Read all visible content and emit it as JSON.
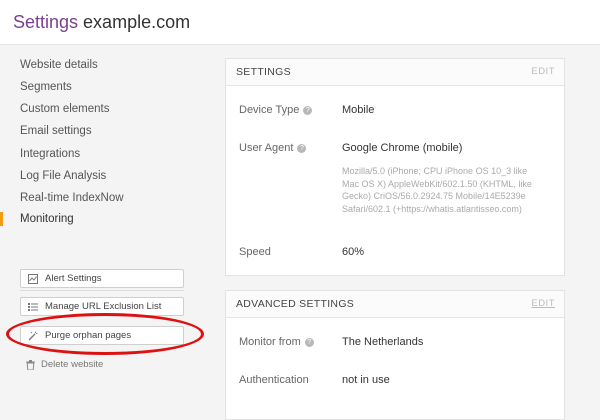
{
  "header": {
    "title_accent": "Settings",
    "title_rest": " example.com"
  },
  "sidebar": {
    "items": [
      {
        "label": "Website details"
      },
      {
        "label": "Segments"
      },
      {
        "label": "Custom elements"
      },
      {
        "label": "Email settings"
      },
      {
        "label": "Integrations"
      },
      {
        "label": "Log File Analysis"
      },
      {
        "label": "Real-time IndexNow"
      },
      {
        "label": "Monitoring"
      }
    ],
    "active_item": "Monitoring",
    "buttons": [
      {
        "label": "Alert Settings",
        "icon": "chart-icon"
      },
      {
        "label": "Manage URL Exclusion List",
        "icon": "list-icon"
      },
      {
        "label": "Purge orphan pages",
        "icon": "magic-wand-icon"
      }
    ],
    "delete_label": "Delete website",
    "accent_color": "#f39c12",
    "highlight_color": "#dd1111"
  },
  "settings": {
    "title": "SETTINGS",
    "edit": "EDIT",
    "rows": {
      "device_type": {
        "label": "Device Type",
        "value": "Mobile"
      },
      "user_agent": {
        "label": "User Agent",
        "value": "Google Chrome (mobile)",
        "raw": "Mozilla/5.0 (iPhone; CPU iPhone OS 10_3 like Mac OS X) AppleWebKit/602.1.50 (KHTML, like Gecko) CriOS/56.0.2924.75 Mobile/14E5239e Safari/602.1 (+https://whatis.atlantisseo.com)"
      },
      "speed": {
        "label": "Speed",
        "value": "60%"
      }
    }
  },
  "advanced": {
    "title": "ADVANCED SETTINGS",
    "edit": "EDIT",
    "rows": {
      "monitor_from": {
        "label": "Monitor from",
        "value": "The Netherlands"
      },
      "authentication": {
        "label": "Authentication",
        "value": "not in use"
      }
    }
  }
}
